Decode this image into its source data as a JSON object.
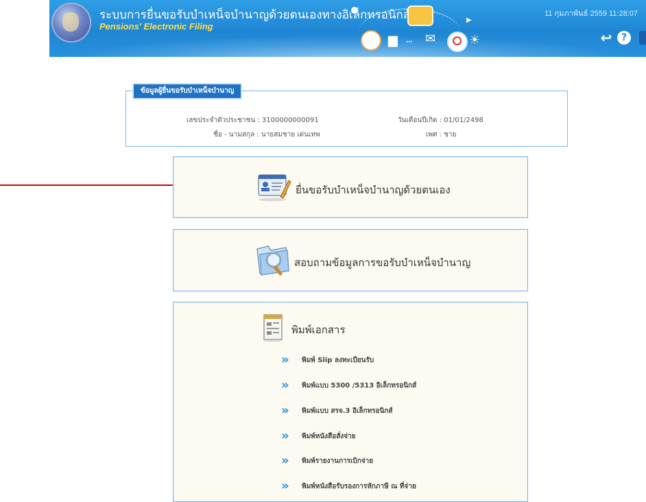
{
  "header": {
    "title_th": "ระบบการยื่นขอรับบำเหน็จบำนาญด้วยตนเองทางอิเล็กทรอนิกส์",
    "title_en": "Pensions' Electronic Filing",
    "datetime": "11 กุมภาพันธ์ 2559 11:28:07",
    "icons": [
      "back-icon",
      "help-icon",
      "exit-icon"
    ]
  },
  "info": {
    "legend": "ข้อมูลผู้ยื่นขอรับบำเหน็จบำนาญ",
    "id_label": "เลขประจำตัวประชาชน : 3100000000091",
    "name_label": "ชื่อ - นามสกุล : นายสมชาย เด่นเทพ",
    "dob_label": "วันเดือนปีเกิด : 01/01/2498",
    "gender_label": "เพศ : ชาย"
  },
  "menu": {
    "apply_label": "ยื่นขอรับบำเหน็จบำนาญด้วยตนเอง",
    "inquiry_label": "สอบถามข้อมูลการขอรับบำเหน็จบำนาญ",
    "print_label": "พิมพ์เอกสาร",
    "print_items": [
      "พิมพ์ Slip ลงทะเบียนรับ",
      "พิมพ์แบบ 5300 /5313 อิเล็กทรอนิกส์",
      "พิมพ์แบบ สรจ.3 อิเล็กทรอนิกส์",
      "พิมพ์หนังสือสั่งจ่าย",
      "พิมพ์รายงานการเบิกจ่าย",
      "พิมพ์หนังสือรับรองการหักภาษี ณ ที่จ่าย"
    ]
  },
  "colors": {
    "header_blue": "#1f86d4",
    "panel_border": "#7fb6e6",
    "box_bg": "#fdfaf1",
    "chevron": "#2a8fd8",
    "annotation_arrow": "#e00000",
    "title_en": "#ffe04a"
  }
}
